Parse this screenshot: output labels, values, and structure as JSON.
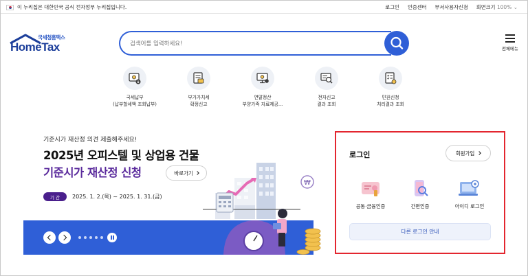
{
  "topbar": {
    "gov_notice": "이 누리집은 대한민국 공식 전자정부 누리집입니다.",
    "links": [
      "로그인",
      "인증센터",
      "부서사용자신청"
    ],
    "zoom_label": "화면크기",
    "zoom_value": "100%"
  },
  "header": {
    "logo_sub": "국세청홈택스",
    "logo_main": "HomeTax",
    "search_placeholder": "검색어를 입력하세요!",
    "allmenu_label": "전체메뉴"
  },
  "quick_menu": [
    {
      "line1": "국세납부",
      "line2": "(납부할세액 조회납부)",
      "icon": "tax-payment-icon"
    },
    {
      "line1": "부가가치세",
      "line2": "확정신고",
      "icon": "vat-document-icon"
    },
    {
      "line1": "연말정산",
      "line2": "부양가족 자료제공...",
      "icon": "year-end-settlement-icon"
    },
    {
      "line1": "전자신고",
      "line2": "결과 조회",
      "icon": "e-filing-result-icon"
    },
    {
      "line1": "민원신청",
      "line2": "처리결과 조회",
      "icon": "civil-petition-icon"
    }
  ],
  "banner": {
    "subtitle": "기준시가 재산정 의견 제출해주세요!",
    "title_line1": "2025년 오피스텔 및 상업용 건물",
    "title_line2": "기준시가 재산정 신청",
    "shortcut_label": "바로가기",
    "period_badge": "기 간",
    "period_text": "2025. 1. 2.(목) ~ 2025. 1. 31.(금)"
  },
  "login": {
    "title": "로그인",
    "join_label": "회원가입",
    "options": [
      {
        "label": "공동·금융인증",
        "icon": "certificate-icon"
      },
      {
        "label": "간편인증",
        "icon": "simple-auth-icon"
      },
      {
        "label": "아이디 로그인",
        "icon": "id-login-icon"
      }
    ],
    "other_login_label": "다른 로그인 안내"
  },
  "colors": {
    "brand_blue": "#2f5fd7",
    "banner_purple": "#5a2a9c",
    "highlight_red": "#e3262f"
  }
}
